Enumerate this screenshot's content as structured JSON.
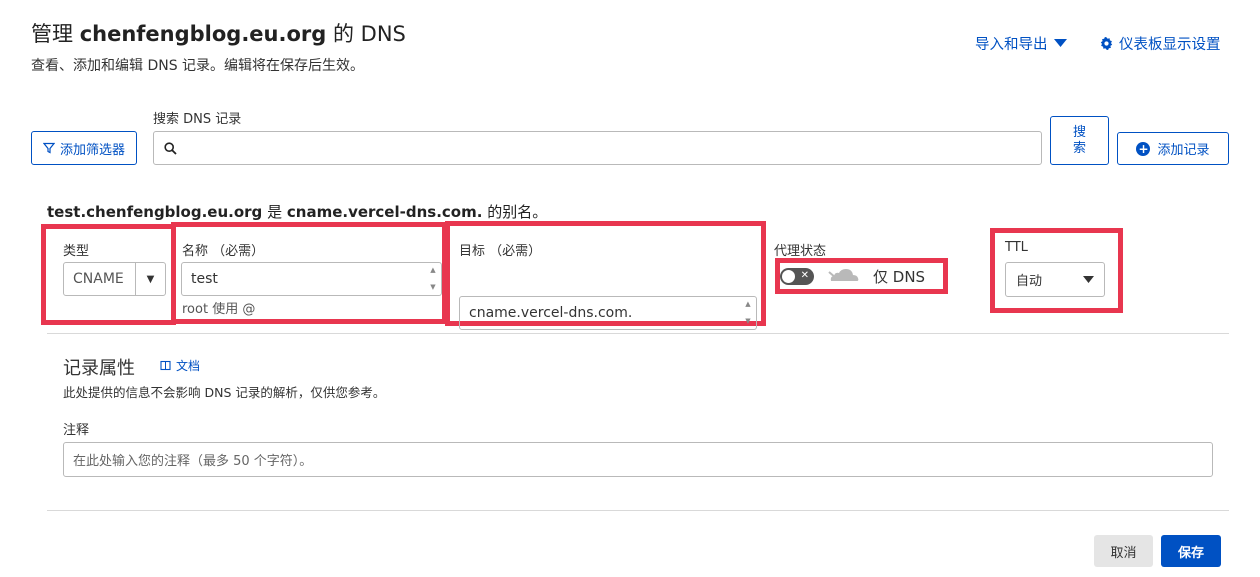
{
  "header": {
    "title_prefix": "管理",
    "title_domain": "chenfengblog.eu.org",
    "title_suffix": "的 DNS",
    "subtitle": "查看、添加和编辑 DNS 记录。编辑将在保存后生效。",
    "import_export_label": "导入和导出",
    "dashboard_settings_label": "仪表板显示设置"
  },
  "toolbar": {
    "filter_label": "添加筛选器",
    "search_label": "搜索 DNS 记录",
    "search_placeholder": "",
    "search_button_line1": "搜",
    "search_button_line2": "索",
    "add_record_label": "添加记录"
  },
  "record": {
    "alias_name": "test.chenfengblog.eu.org",
    "alias_is": "是",
    "alias_target": "cname.vercel-dns.com.",
    "alias_tail": "的别名。",
    "type_label": "类型",
    "type_value": "CNAME",
    "name_label": "名称 （必需）",
    "name_value": "test",
    "name_hint": "root 使用 @",
    "target_label": "目标 （必需）",
    "target_value": "cname.vercel-dns.com.",
    "proxy_label": "代理状态",
    "proxy_state": "仅 DNS",
    "proxy_enabled": false,
    "ttl_label": "TTL",
    "ttl_value": "自动"
  },
  "properties": {
    "title": "记录属性",
    "docs_label": "文档",
    "description": "此处提供的信息不会影响 DNS 记录的解析，仅供您参考。",
    "comment_label": "注释",
    "comment_placeholder": "在此处输入您的注释（最多 50 个字符）。"
  },
  "actions": {
    "cancel_label": "取消",
    "save_label": "保存"
  },
  "colors": {
    "accent": "#0051c3",
    "highlight_box": "#e8364f",
    "toggle_off": "#555555"
  },
  "icons": {
    "import_export": "caret-down-icon",
    "settings": "gear-icon",
    "filter": "funnel-icon",
    "search": "magnifier-icon",
    "add": "plus-circle-icon",
    "proxy": "cloud-icon",
    "docs": "book-icon"
  }
}
